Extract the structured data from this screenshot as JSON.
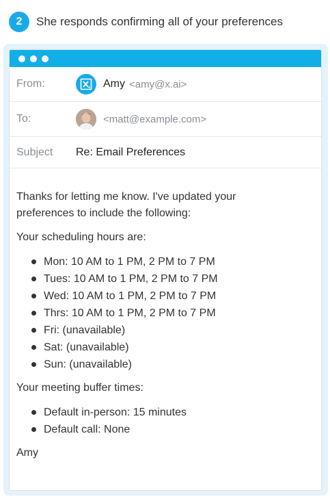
{
  "step": {
    "number": "2",
    "text": "She responds confirming all of your preferences"
  },
  "email": {
    "from": {
      "label": "From:",
      "name": "Amy",
      "address": "<amy@x.ai>",
      "avatar_icon": "x-ai-logo-icon"
    },
    "to": {
      "label": "To:",
      "address": "<matt@example.com>",
      "avatar_icon": "user-photo"
    },
    "subject": {
      "label": "Subject",
      "value": "Re: Email Preferences"
    },
    "body": {
      "intro_line1": "Thanks for letting me know. I've updated your",
      "intro_line2": "preferences to include the following:",
      "hours_heading": "Your scheduling hours are:",
      "hours": [
        "Mon: 10 AM to 1 PM, 2 PM to 7 PM",
        "Tues: 10 AM to 1 PM, 2 PM to 7 PM",
        "Wed: 10 AM to 1 PM, 2 PM to 7 PM",
        "Thrs: 10 AM to 1 PM, 2 PM to 7 PM",
        "Fri: (unavailable)",
        "Sat: (unavailable)",
        "Sun: (unavailable)"
      ],
      "buffer_heading": "Your meeting buffer times:",
      "buffers": [
        "Default in-person: 15 minutes",
        "Default call: None"
      ],
      "signature": "Amy"
    }
  },
  "colors": {
    "accent": "#12aee8",
    "frame_bg": "#e4f2fb",
    "label_gray": "#8a8f94"
  }
}
